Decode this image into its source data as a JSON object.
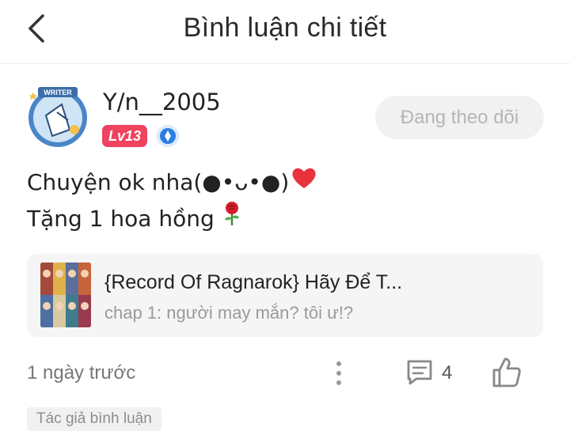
{
  "header": {
    "title": "Bình luận chi tiết",
    "back_icon": "chevron-left-icon"
  },
  "user": {
    "name": "Y/n__2005",
    "level": "Lv13",
    "avatar_badge": "WRITER",
    "verified_icon": "verified-badge-icon",
    "follow_label": "Đang theo dõi"
  },
  "comment": {
    "line1": "Chuyện ok nha(●•ᴗ•●)",
    "line2": "Tặng 1 hoa hồng",
    "emoji": [
      "heart-icon",
      "rose-icon"
    ]
  },
  "story": {
    "title": "{Record Of Ragnarok} Hãy Để T...",
    "chapter": "chap 1: người may mắn? tôi ư!?"
  },
  "footer": {
    "timestamp": "1 ngày trước",
    "reply_count": "4",
    "author_tag": "Tác giả bình luận"
  },
  "colors": {
    "level_badge": "#f0435f",
    "verified": "#2a7de1",
    "heart": "#e8323c",
    "follow_bg": "#f1f1f1"
  }
}
